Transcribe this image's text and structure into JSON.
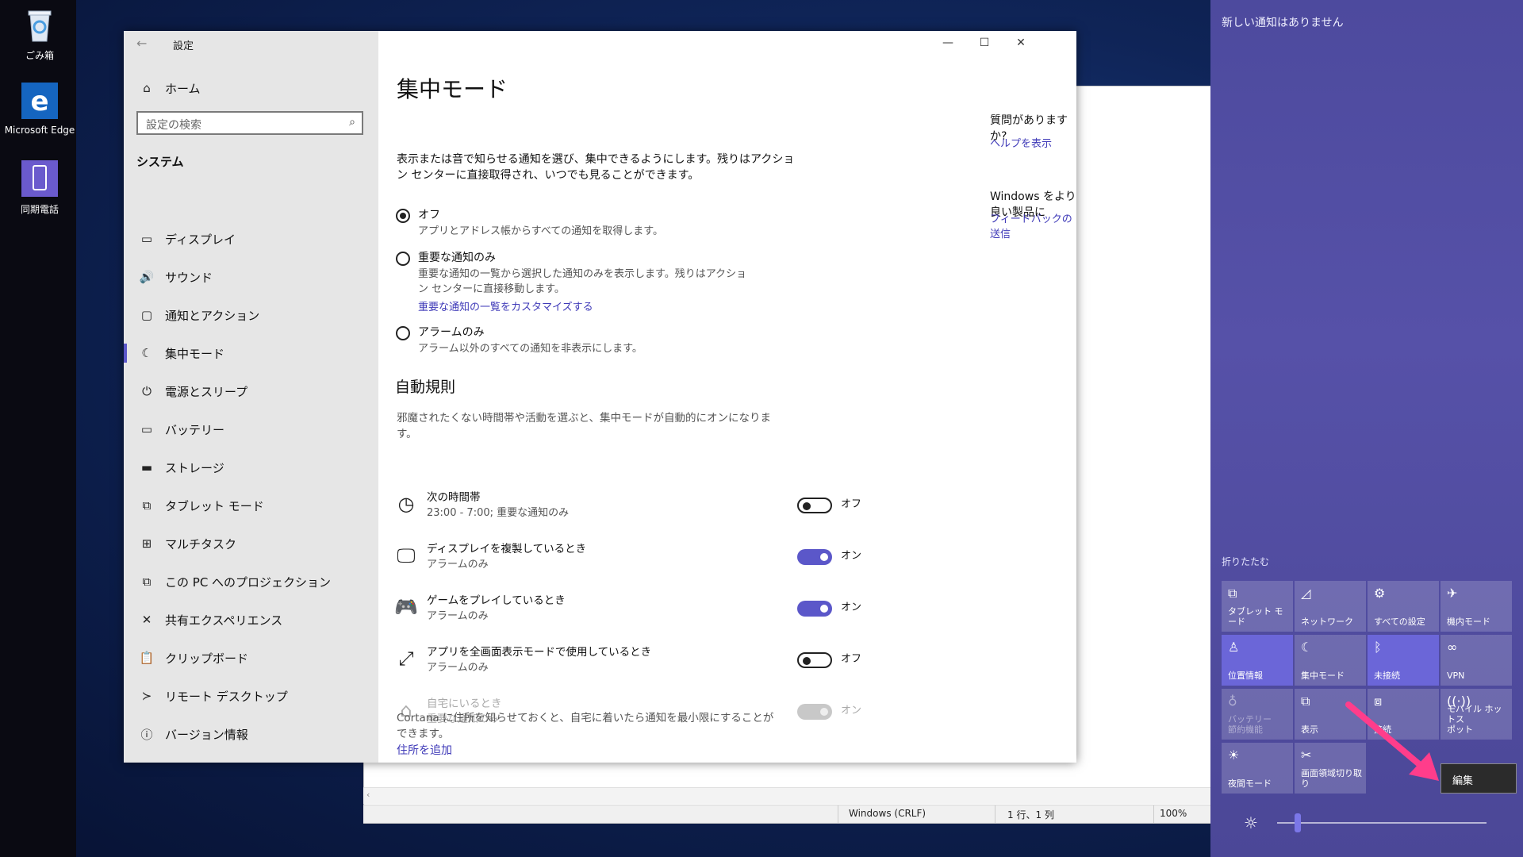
{
  "desktop": {
    "icons": [
      {
        "label": "ごみ箱",
        "icon": "recycle-bin-icon"
      },
      {
        "label": "Microsoft Edge",
        "icon": "edge-icon"
      },
      {
        "label": "同期電話",
        "icon": "phone-icon"
      }
    ]
  },
  "notepad": {
    "status_encoding": "Windows (CRLF)",
    "status_position": "1 行、1 列",
    "status_zoom": "100%"
  },
  "settings": {
    "title": "設定",
    "home": "ホーム",
    "search_placeholder": "設定の検索",
    "category": "システム",
    "nav": [
      {
        "label": "ディスプレイ",
        "icon": "display-icon"
      },
      {
        "label": "サウンド",
        "icon": "sound-icon"
      },
      {
        "label": "通知とアクション",
        "icon": "notification-icon"
      },
      {
        "label": "集中モード",
        "icon": "moon-icon",
        "selected": true
      },
      {
        "label": "電源とスリープ",
        "icon": "power-icon"
      },
      {
        "label": "バッテリー",
        "icon": "battery-icon"
      },
      {
        "label": "ストレージ",
        "icon": "storage-icon"
      },
      {
        "label": "タブレット モード",
        "icon": "tablet-icon"
      },
      {
        "label": "マルチタスク",
        "icon": "multitask-icon"
      },
      {
        "label": "この PC へのプロジェクション",
        "icon": "projection-icon"
      },
      {
        "label": "共有エクスペリエンス",
        "icon": "share-icon"
      },
      {
        "label": "クリップボード",
        "icon": "clipboard-icon"
      },
      {
        "label": "リモート デスクトップ",
        "icon": "remote-icon"
      },
      {
        "label": "バージョン情報",
        "icon": "info-icon"
      }
    ],
    "page_title": "集中モード",
    "intro": [
      "表示または音で知らせる通知を選び、集中できるようにします。残りはアクショ",
      "ン センターに直接取得され、いつでも見ることができます。"
    ],
    "options": [
      {
        "label": "オフ",
        "desc": "アプリとアドレス帳からすべての通知を取得します。",
        "selected": true
      },
      {
        "label": "重要な通知のみ",
        "desc1": "重要な通知の一覧から選択した通知のみを表示します。残りはアクショ",
        "desc2": "ン センターに直接移動します。",
        "link": "重要な通知の一覧をカスタマイズする"
      },
      {
        "label": "アラームのみ",
        "desc": "アラーム以外のすべての通知を非表示にします。"
      }
    ],
    "auto_rules_title": "自動規則",
    "auto_rules_desc": [
      "邪魔されたくない時間帯や活動を選ぶと、集中モードが自動的にオンになりま",
      "す。"
    ],
    "rules": [
      {
        "title": "次の時間帯",
        "sub": "23:00 - 7:00; 重要な通知のみ",
        "state": "オフ",
        "on": false,
        "icon": "clock-icon"
      },
      {
        "title": "ディスプレイを複製しているとき",
        "sub": "アラームのみ",
        "state": "オン",
        "on": true,
        "icon": "monitor-icon"
      },
      {
        "title": "ゲームをプレイしているとき",
        "sub": "アラームのみ",
        "state": "オン",
        "on": true,
        "icon": "gamepad-icon"
      },
      {
        "title": "アプリを全画面表示モードで使用しているとき",
        "sub": "アラームのみ",
        "state": "オフ",
        "on": false,
        "icon": "fullscreen-icon"
      },
      {
        "title": "自宅にいるとき",
        "sub": "重要な通知のみ",
        "state": "オン",
        "on": true,
        "disabled": true,
        "icon": "home-icon"
      }
    ],
    "cortana_text": [
      "Cortana に住所を知らせておくと、自宅に着いたら通知を最小限にすることが",
      "できます。"
    ],
    "cortana_link": "住所を追加",
    "side_q": "質問がありますか?",
    "side_help": "ヘルプを表示",
    "side_better": "Windows をより良い製品に",
    "side_feedback": "フィードバックの送信"
  },
  "action_center": {
    "no_notifications": "新しい通知はありません",
    "collapse": "折りたたむ",
    "tiles": [
      {
        "label": "タブレット モード",
        "icon": "tablet-mode-icon",
        "on": false
      },
      {
        "label": "ネットワーク",
        "icon": "network-icon",
        "on": false
      },
      {
        "label": "すべての設定",
        "icon": "settings-gear-icon",
        "on": false
      },
      {
        "label": "機内モード",
        "icon": "airplane-icon",
        "on": false
      },
      {
        "label": "位置情報",
        "icon": "location-icon",
        "on": true
      },
      {
        "label": "集中モード",
        "icon": "focus-moon-icon",
        "on": false
      },
      {
        "label": "未接続",
        "icon": "bluetooth-icon",
        "on": true
      },
      {
        "label": "VPN",
        "icon": "vpn-icon",
        "on": false
      },
      {
        "label": "バッテリー\n節約機能",
        "icon": "battery-saver-icon",
        "on": false,
        "dim": true
      },
      {
        "label": "表示",
        "icon": "project-icon",
        "on": false
      },
      {
        "label": "接続",
        "icon": "connect-icon",
        "on": false
      },
      {
        "label": "モバイル ホットス\nポット",
        "icon": "hotspot-icon",
        "on": false
      },
      {
        "label": "夜間モード",
        "icon": "night-light-icon",
        "on": false
      },
      {
        "label": "画面領域切り取\nり",
        "icon": "snip-icon",
        "on": false
      }
    ],
    "edit_label": "編集",
    "brightness": 0.1,
    "arrow_color": "#ff3d8b"
  },
  "colors": {
    "accent": "#5b57c9",
    "link": "#3f3ab8",
    "action_center": "#5651a8"
  }
}
